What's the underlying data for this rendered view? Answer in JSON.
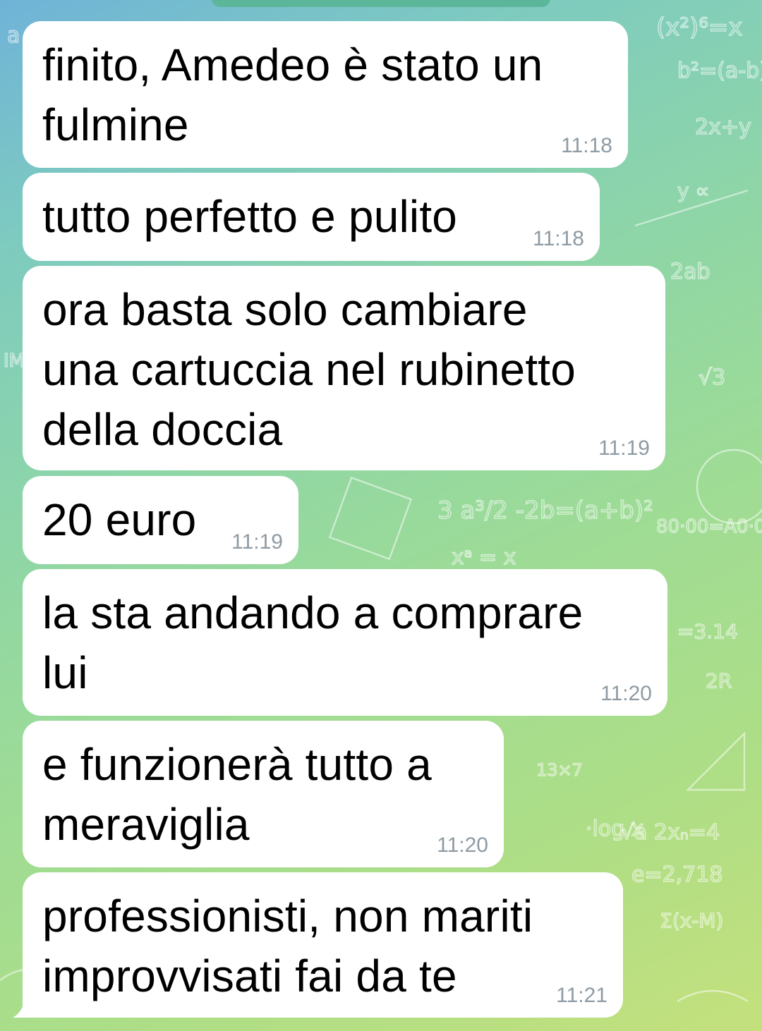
{
  "messages": [
    {
      "text_lines": [
        "finito, Amedeo è stato un",
        "fulmine"
      ],
      "time": "11:18"
    },
    {
      "text_lines": [
        "tutto perfetto e pulito"
      ],
      "time": "11:18"
    },
    {
      "text_lines": [
        "ora basta solo cambiare",
        "una cartuccia nel rubinetto",
        "della doccia"
      ],
      "time": "11:19"
    },
    {
      "text_lines": [
        "20 euro"
      ],
      "time": "11:19"
    },
    {
      "text_lines": [
        "la sta andando a comprare",
        "lui"
      ],
      "time": "11:20"
    },
    {
      "text_lines": [
        "e funzionerà tutto a",
        "meraviglia"
      ],
      "time": "11:20"
    },
    {
      "text_lines": [
        "professionisti, non mariti",
        "improvvisati fai da te"
      ],
      "time": "11:21"
    }
  ],
  "colors": {
    "bubble": "#ffffff",
    "timestamp": "#8e9ba4",
    "background_start": "#6fb3d8",
    "background_end": "#c4e07d"
  }
}
